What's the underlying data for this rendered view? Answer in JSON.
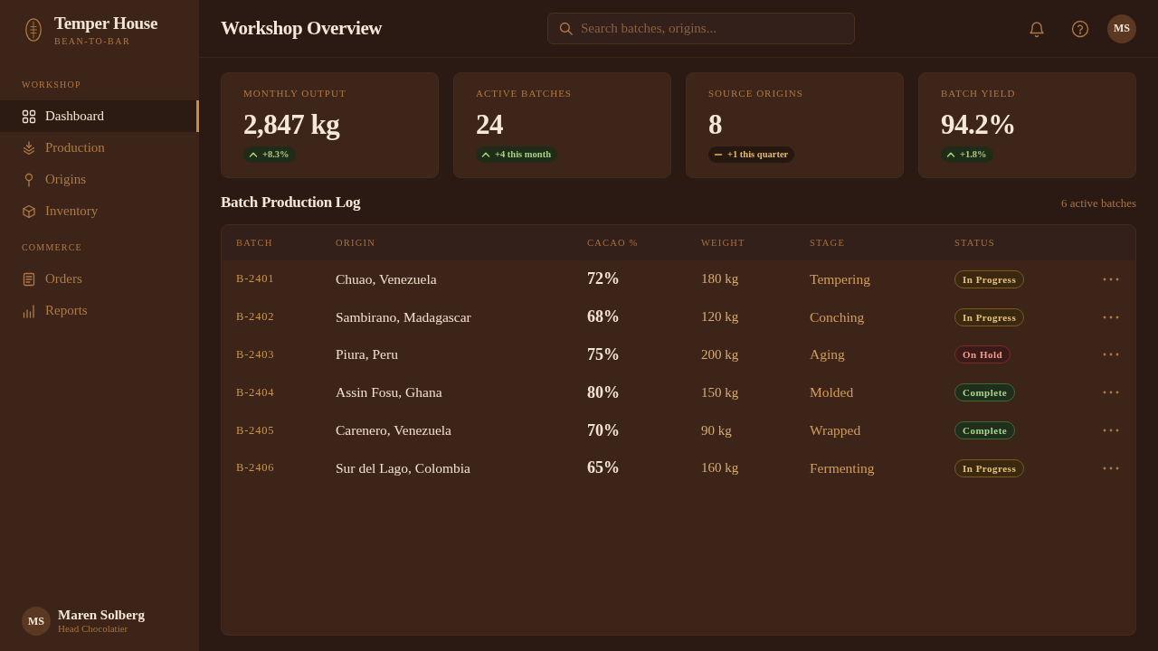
{
  "sidebar": {
    "brand": {
      "name": "Temper House",
      "tagline": "BEAN-TO-BAR"
    },
    "sections": [
      {
        "label": "WORKSHOP",
        "items": [
          {
            "label": "Dashboard",
            "selected": true
          },
          {
            "label": "Production",
            "selected": false
          },
          {
            "label": "Origins",
            "selected": false
          },
          {
            "label": "Inventory",
            "selected": false
          }
        ]
      },
      {
        "label": "COMMERCE",
        "items": [
          {
            "label": "Orders",
            "selected": false
          },
          {
            "label": "Reports",
            "selected": false
          }
        ]
      }
    ],
    "user": {
      "initials": "MS",
      "name": "Maren Solberg",
      "role": "Head Chocolatier"
    }
  },
  "header": {
    "title": "Workshop Overview",
    "search": {
      "placeholder": "Search batches, origins..."
    },
    "user_initials": "MS"
  },
  "kpis": [
    {
      "label": "MONTHLY OUTPUT",
      "value": "2,847 kg",
      "delta": {
        "text": "+8.3%",
        "kind": "up"
      }
    },
    {
      "label": "ACTIVE BATCHES",
      "value": "24",
      "delta": {
        "text": "+4 this month",
        "kind": "up"
      }
    },
    {
      "label": "SOURCE ORIGINS",
      "value": "8",
      "delta": {
        "text": "+1 this quarter",
        "kind": "flat"
      }
    },
    {
      "label": "BATCH YIELD",
      "value": "94.2%",
      "delta": {
        "text": "+1.8%",
        "kind": "up"
      }
    }
  ],
  "batch_log": {
    "title": "Batch Production Log",
    "count": "6 active batches",
    "columns": [
      "BATCH",
      "ORIGIN",
      "CACAO %",
      "WEIGHT",
      "STAGE",
      "STATUS"
    ],
    "rows": [
      {
        "batch": "B-2401",
        "origin": "Chuao, Venezuela",
        "cacao": "72%",
        "weight": "180 kg",
        "stage": "Tempering",
        "status": {
          "label": "In Progress",
          "kind": "progress"
        }
      },
      {
        "batch": "B-2402",
        "origin": "Sambirano, Madagascar",
        "cacao": "68%",
        "weight": "120 kg",
        "stage": "Conching",
        "status": {
          "label": "In Progress",
          "kind": "progress"
        }
      },
      {
        "batch": "B-2403",
        "origin": "Piura, Peru",
        "cacao": "75%",
        "weight": "200 kg",
        "stage": "Aging",
        "status": {
          "label": "On Hold",
          "kind": "hold"
        }
      },
      {
        "batch": "B-2404",
        "origin": "Assin Fosu, Ghana",
        "cacao": "80%",
        "weight": "150 kg",
        "stage": "Molded",
        "status": {
          "label": "Complete",
          "kind": "complete"
        }
      },
      {
        "batch": "B-2405",
        "origin": "Carenero, Venezuela",
        "cacao": "70%",
        "weight": "90 kg",
        "stage": "Wrapped",
        "status": {
          "label": "Complete",
          "kind": "complete"
        }
      },
      {
        "batch": "B-2406",
        "origin": "Sur del Lago, Colombia",
        "cacao": "65%",
        "weight": "160 kg",
        "stage": "Fermenting",
        "status": {
          "label": "In Progress",
          "kind": "progress"
        }
      }
    ]
  }
}
